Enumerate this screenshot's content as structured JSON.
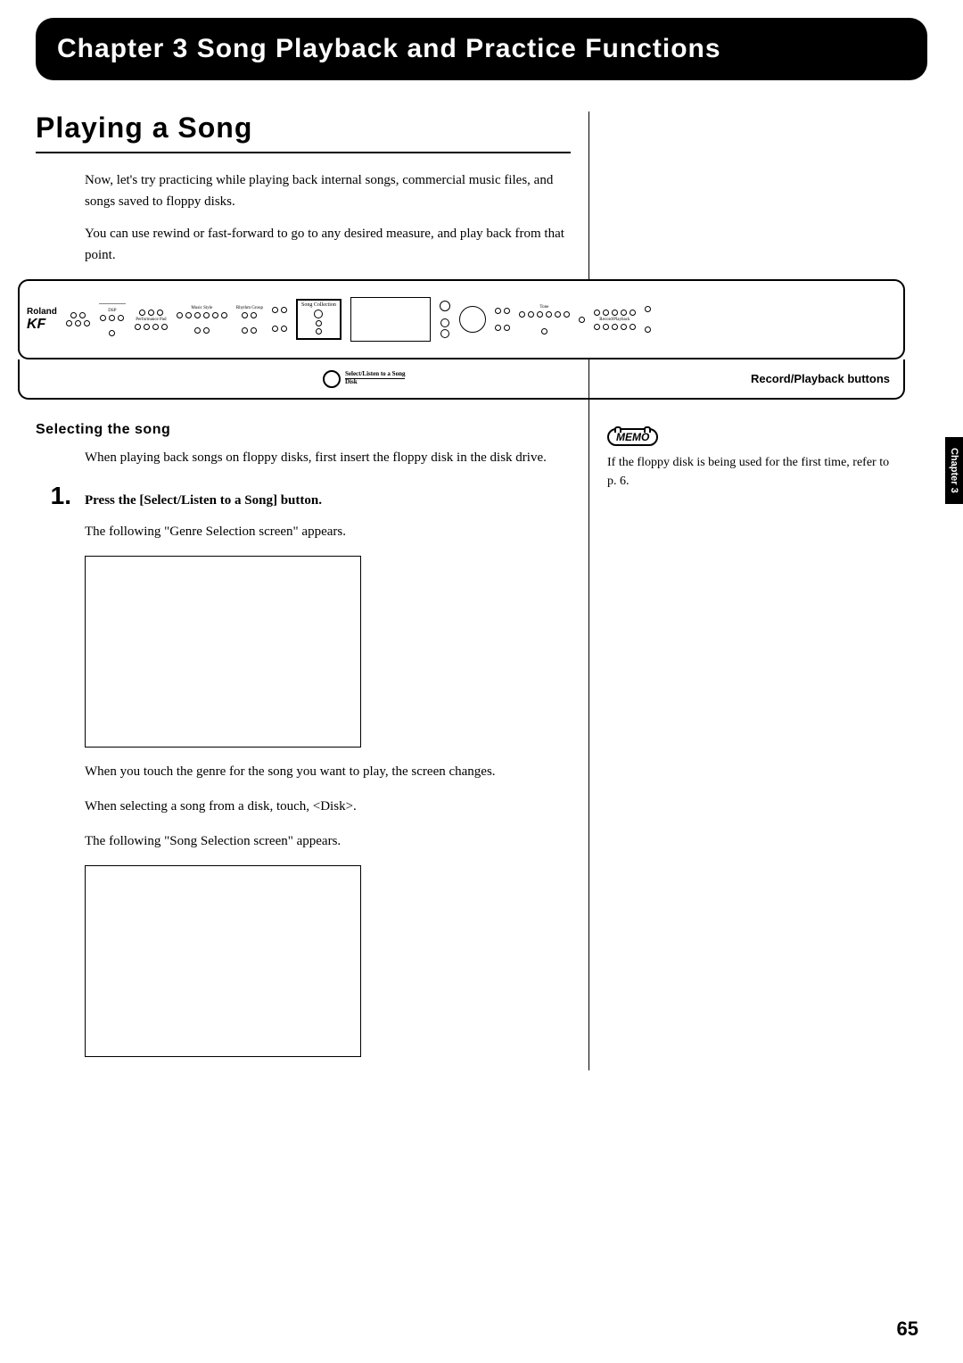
{
  "chapter": {
    "header": "Chapter 3 Song Playback and Practice Functions",
    "sideTab": "Chapter 3"
  },
  "section": {
    "title": "Playing a Song",
    "intro1": "Now, let's try practicing while playing back internal songs, commercial music files, and songs saved to floppy disks.",
    "intro2": "You can use rewind or fast-forward to go to any desired measure, and play back from that point."
  },
  "diagram": {
    "brand": "Roland",
    "model": "KF",
    "songCollection": "Song Collection",
    "dsp": "DSP",
    "musicStyle": "Music Style",
    "rhythmGroup": "Rhythm Group",
    "performancePad": "Performance Pad",
    "selectListen": "Select/Listen to a Song",
    "disk": "Disk",
    "tone": "Tone",
    "recordPlayback": "Record/Playback",
    "recordLabel": "Record/Playback buttons"
  },
  "subsection": {
    "title": "Selecting the song",
    "text1": "When playing back songs on floppy disks, first insert the floppy disk in the disk drive.",
    "step1num": "1.",
    "step1text": "Press the [Select/Listen to a Song] button.",
    "text2": "The following \"Genre Selection screen\" appears.",
    "text3": "When you touch the genre for the song you want to play, the screen changes.",
    "text4": "When selecting a song from a disk, touch, <Disk>.",
    "text5": "The following \"Song Selection screen\" appears."
  },
  "memo": {
    "label": "MEMO",
    "text": "If the floppy disk is being used for the first time, refer to p. 6."
  },
  "pageNumber": "65"
}
